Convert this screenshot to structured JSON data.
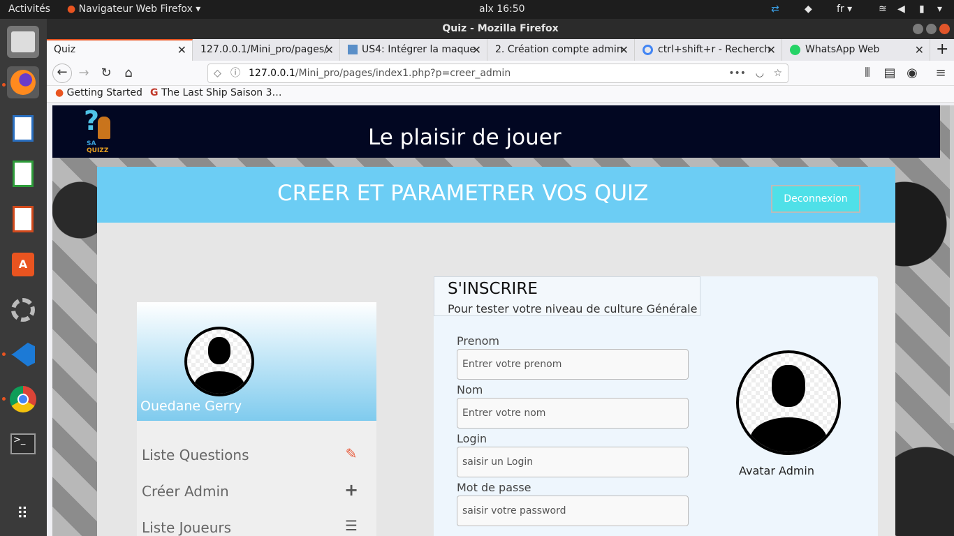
{
  "topbar": {
    "activities": "Activités",
    "app_menu": "Navigateur Web Firefox",
    "clock": "alx 16:50",
    "lang": "fr"
  },
  "window": {
    "title": "Quiz - Mozilla Firefox"
  },
  "tabs": [
    {
      "label": "Quiz"
    },
    {
      "label": "127.0.0.1/Mini_pro/pages/"
    },
    {
      "label": "US4: Intégrer la maque"
    },
    {
      "label": "2. Création compte admin"
    },
    {
      "label": "ctrl+shift+r - Recherch"
    },
    {
      "label": "WhatsApp Web"
    }
  ],
  "url": {
    "host": "127.0.0.1",
    "path": "/Mini_pro/pages/index1.php?p=creer_admin"
  },
  "bookmarks": [
    {
      "label": "Getting Started"
    },
    {
      "label": "The Last Ship Saison 3…"
    }
  ],
  "site": {
    "logo_text_top": "SA",
    "logo_text_bottom": "QUIZZ",
    "slogan": "Le plaisir de jouer",
    "panel_title": "CREER ET PARAMETRER VOS QUIZ",
    "logout_label": "Deconnexion"
  },
  "sidebar": {
    "user_name": "Ouedane  Gerry",
    "items": [
      {
        "label": "Liste Questions",
        "icon": "edit-list-icon"
      },
      {
        "label": "Créer Admin",
        "icon": "plus-icon"
      },
      {
        "label": "Liste Joueurs",
        "icon": "list-icon"
      }
    ]
  },
  "form": {
    "title": "S'INSCRIRE",
    "subtitle": "Pour tester votre niveau de culture Générale",
    "fields": [
      {
        "label": "Prenom",
        "placeholder": "Entrer votre prenom"
      },
      {
        "label": "Nom",
        "placeholder": "Entrer votre nom"
      },
      {
        "label": "Login",
        "placeholder": "saisir un Login"
      },
      {
        "label": "Mot de passe",
        "placeholder": "saisir votre password"
      }
    ],
    "avatar_label": "Avatar Admin"
  },
  "colors": {
    "header_bg": "#020722",
    "panel_blue": "#6ccdf4",
    "logout_bg": "#4fe0e8",
    "accent": "#e95420"
  }
}
